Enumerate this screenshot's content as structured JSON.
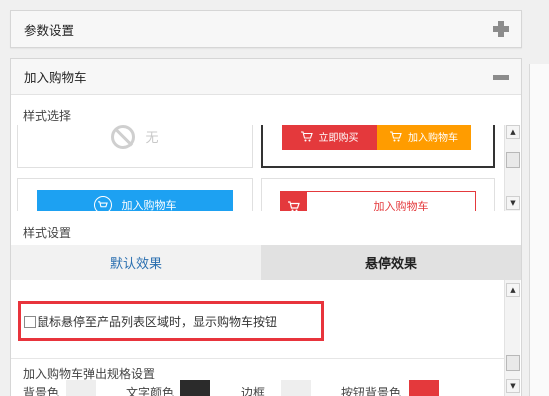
{
  "panels": {
    "params": {
      "title": "参数设置"
    },
    "cart": {
      "title": "加入购物车"
    }
  },
  "style_select": {
    "label": "样式选择",
    "options": {
      "none": {
        "label": "无"
      },
      "selected": {
        "buy_label": "立即购买",
        "add_label": "加入购物车"
      },
      "blue": {
        "label": "加入购物车"
      },
      "red": {
        "label": "加入购物车"
      }
    }
  },
  "style_settings": {
    "label": "样式设置"
  },
  "tabs": [
    {
      "label": "默认效果",
      "active": true
    },
    {
      "label": "悬停效果",
      "active": false
    }
  ],
  "hover_option": {
    "label": "鼠标悬停至产品列表区域时，显示购物车按钮",
    "checked": false
  },
  "spec_popup": {
    "label": "加入购物车弹出规格设置"
  },
  "swatches": [
    {
      "label": "背景色",
      "color": "#eeeeee"
    },
    {
      "label": "文字颜色",
      "color": "#2b2b2b"
    },
    {
      "label": "边框",
      "color": "#eeeeee"
    },
    {
      "label": "按钮背景色",
      "color": "#e4393c"
    }
  ],
  "colors": {
    "accent_red": "#e4393c",
    "accent_orange": "#ff9c00",
    "accent_blue": "#1da1f2",
    "highlight": "#e8343c",
    "tab_active_text": "#2a6fb0"
  }
}
